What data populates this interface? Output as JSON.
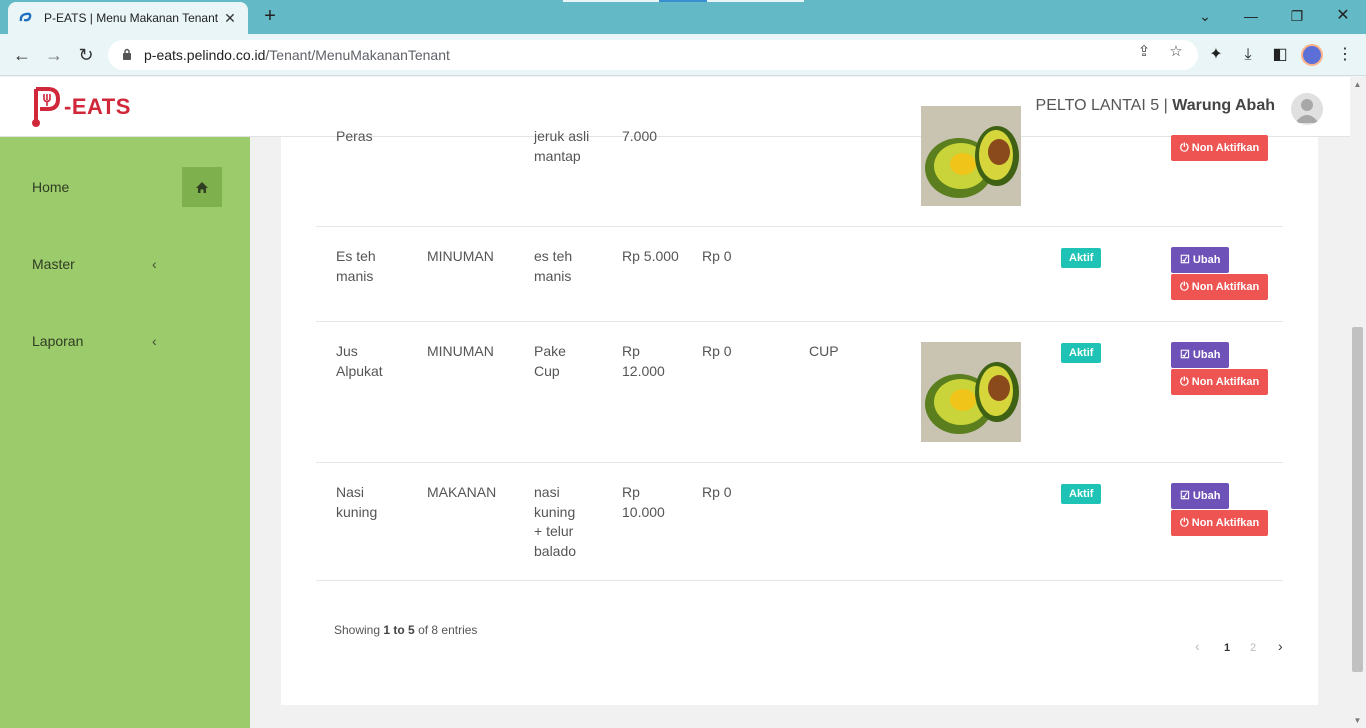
{
  "browser": {
    "tab_title": "P-EATS | Menu Makanan Tenant",
    "url_host": "p-eats.pelindo.co.id",
    "url_path": "/Tenant/MenuMakananTenant"
  },
  "header": {
    "logo_text": "-EATS",
    "location": "PELTO LANTAI 5 |",
    "tenant_name": "Warung Abah"
  },
  "sidebar": {
    "items": [
      {
        "label": "Home"
      },
      {
        "label": "Master"
      },
      {
        "label": "Laporan"
      }
    ]
  },
  "table": {
    "rows": [
      {
        "name": "Peras",
        "category": "",
        "description": "jeruk asli mantap",
        "price": "7.000",
        "discount": "",
        "unit": "",
        "has_image": true,
        "status": "",
        "edit_label": "",
        "toggle_label": "Non Aktifkan"
      },
      {
        "name": "Es teh manis",
        "category": "MINUMAN",
        "description": "es teh manis",
        "price": "Rp 5.000",
        "discount": "Rp 0",
        "unit": "",
        "has_image": false,
        "status": "Aktif",
        "edit_label": "Ubah",
        "toggle_label": "Non Aktifkan"
      },
      {
        "name": "Jus Alpukat",
        "category": "MINUMAN",
        "description": "Pake Cup",
        "price": "Rp 12.000",
        "discount": "Rp 0",
        "unit": "CUP",
        "has_image": true,
        "status": "Aktif",
        "edit_label": "Ubah",
        "toggle_label": "Non Aktifkan"
      },
      {
        "name": "Nasi kuning",
        "category": "MAKANAN",
        "description": "nasi kuning + telur balado",
        "price": "Rp 10.000",
        "discount": "Rp 0",
        "unit": "",
        "has_image": false,
        "status": "Aktif",
        "edit_label": "Ubah",
        "toggle_label": "Non Aktifkan"
      }
    ]
  },
  "footer": {
    "showing_prefix": "Showing",
    "showing_range": "1 to 5",
    "showing_suffix": "of 8 entries",
    "pages": [
      "1",
      "2"
    ],
    "prev": "‹",
    "next": "›"
  },
  "colors": {
    "sidebar": "#9ccb6c",
    "brand": "#d0283a",
    "badge_active": "#1fc3b5",
    "btn_edit": "#6f52b8",
    "btn_deactivate": "#ee5452"
  }
}
